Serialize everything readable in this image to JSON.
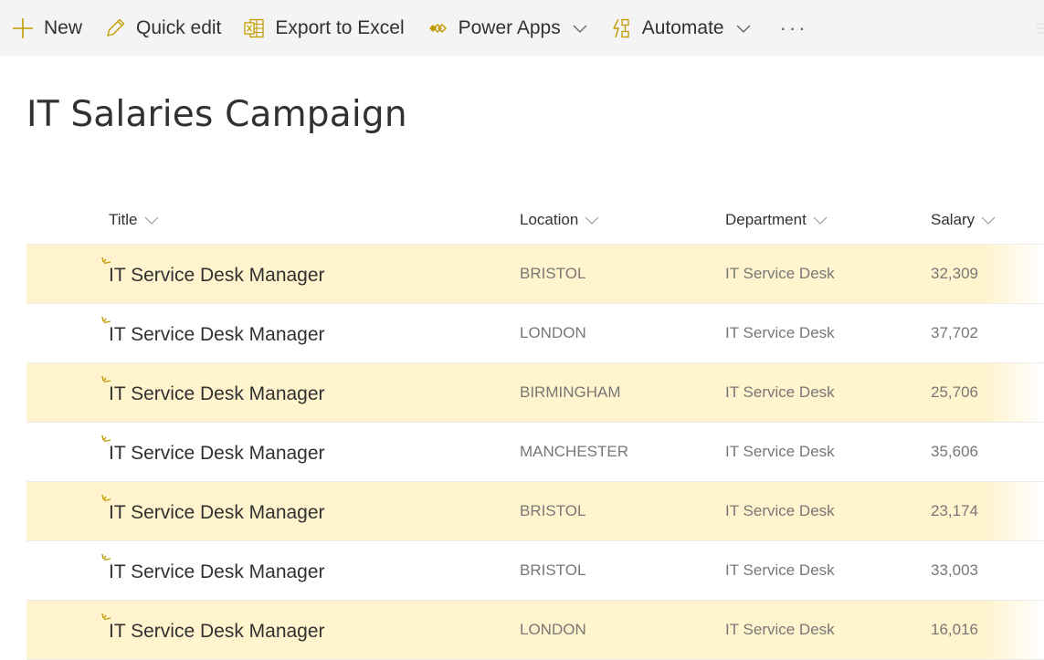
{
  "commandbar": {
    "new_label": "New",
    "quick_edit_label": "Quick edit",
    "export_label": "Export to Excel",
    "power_apps_label": "Power Apps",
    "automate_label": "Automate",
    "more_label": "···",
    "icons": {
      "new": "plus-icon",
      "quick_edit": "pencil-icon",
      "export": "excel-icon",
      "power_apps": "power-apps-icon",
      "automate": "automate-icon"
    }
  },
  "page": {
    "title": "IT Salaries Campaign"
  },
  "list": {
    "columns": [
      "Title",
      "Location",
      "Department",
      "Salary"
    ],
    "rows": [
      {
        "title": "IT Service Desk Manager",
        "location": "BRISTOL",
        "department": "IT Service Desk",
        "salary": "32,309",
        "highlight": true
      },
      {
        "title": "IT Service Desk Manager",
        "location": "LONDON",
        "department": "IT Service Desk",
        "salary": "37,702",
        "highlight": false
      },
      {
        "title": "IT Service Desk Manager",
        "location": "BIRMINGHAM",
        "department": "IT Service Desk",
        "salary": "25,706",
        "highlight": true
      },
      {
        "title": "IT Service Desk Manager",
        "location": "MANCHESTER",
        "department": "IT Service Desk",
        "salary": "35,606",
        "highlight": false
      },
      {
        "title": "IT Service Desk Manager",
        "location": "BRISTOL",
        "department": "IT Service Desk",
        "salary": "23,174",
        "highlight": true
      },
      {
        "title": "IT Service Desk Manager",
        "location": "BRISTOL",
        "department": "IT Service Desk",
        "salary": "33,003",
        "highlight": false
      },
      {
        "title": "IT Service Desk Manager",
        "location": "LONDON",
        "department": "IT Service Desk",
        "salary": "16,016",
        "highlight": true
      }
    ]
  },
  "colors": {
    "highlight_row": "#fff4ce",
    "accent": "#c19c00",
    "commandbar_bg": "#f4f4f4"
  }
}
